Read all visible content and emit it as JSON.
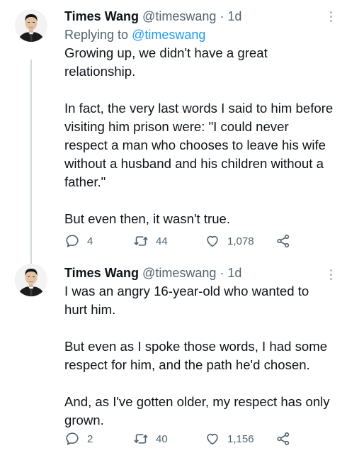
{
  "tweets": [
    {
      "author_name": "Times Wang",
      "author_handle": "@timeswang",
      "separator": "·",
      "time": "1d",
      "replying_prefix": "Replying to ",
      "replying_to": "@timeswang",
      "text": "Growing up, we didn't have a great relationship.\n\nIn fact, the very last words I said to him before visiting him prison were: \"I could never respect a man who chooses to leave his wife without a husband and his children without a father.\"\n\nBut even then, it wasn't true.",
      "reply_count": "4",
      "retweet_count": "44",
      "like_count": "1,078"
    },
    {
      "author_name": "Times Wang",
      "author_handle": "@timeswang",
      "separator": "·",
      "time": "1d",
      "text": "I was an angry 16-year-old who wanted to hurt him.\n\nBut even as I spoke those words, I had some respect for him, and the path he'd chosen.\n\nAnd, as I've gotten older, my respect has only grown.",
      "reply_count": "2",
      "retweet_count": "40",
      "like_count": "1,156"
    }
  ],
  "icons": {
    "reply": "reply-icon",
    "retweet": "retweet-icon",
    "like": "heart-icon",
    "share": "share-icon",
    "more": "more-options-icon"
  },
  "colors": {
    "link": "#1d9bf0",
    "secondary_text": "#536471",
    "thread_line": "#cfd9de"
  }
}
